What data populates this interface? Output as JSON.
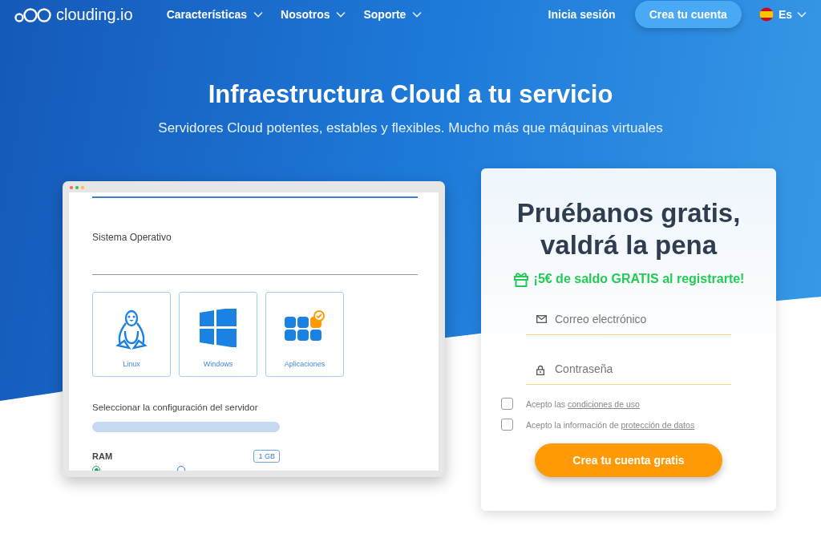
{
  "header": {
    "brand": "clouding.io",
    "menu": [
      {
        "label": "Características"
      },
      {
        "label": "Nosotros"
      },
      {
        "label": "Soporte"
      }
    ],
    "login": "Inicia sesión",
    "signup": "Crea tu cuenta",
    "language": "Es"
  },
  "hero": {
    "title": "Infraestructura Cloud a tu servicio",
    "subtitle": "Servidores Cloud potentes, estables y flexibles. Mucho más que máquinas virtuales"
  },
  "mockup": {
    "section_label": "Sistema Operativo",
    "os_options": [
      {
        "kind": "linux",
        "label": "Linux"
      },
      {
        "kind": "windows",
        "label": "Windows"
      },
      {
        "kind": "apps",
        "label": "Aplicaciones"
      }
    ],
    "config_label": "Seleccionar la configuración del servidor",
    "ram_label": "RAM",
    "ram_value": "1 GB",
    "ram_options": [
      {
        "selected": true
      },
      {
        "selected": false
      }
    ]
  },
  "signup_card": {
    "title": "Pruébanos gratis, valdrá la pena",
    "promo": "¡5€ de saldo GRATIS al registrarte!",
    "email": {
      "placeholder": "Correo electrónico"
    },
    "password": {
      "placeholder": "Contraseña"
    },
    "agreements": [
      {
        "text": "Acepto las ",
        "link": "condiciones de uso",
        "checked": false
      },
      {
        "text": "Acepto la información de ",
        "link": "protección de datos",
        "checked": false
      }
    ],
    "submit": "Crea tu cuenta gratis"
  }
}
